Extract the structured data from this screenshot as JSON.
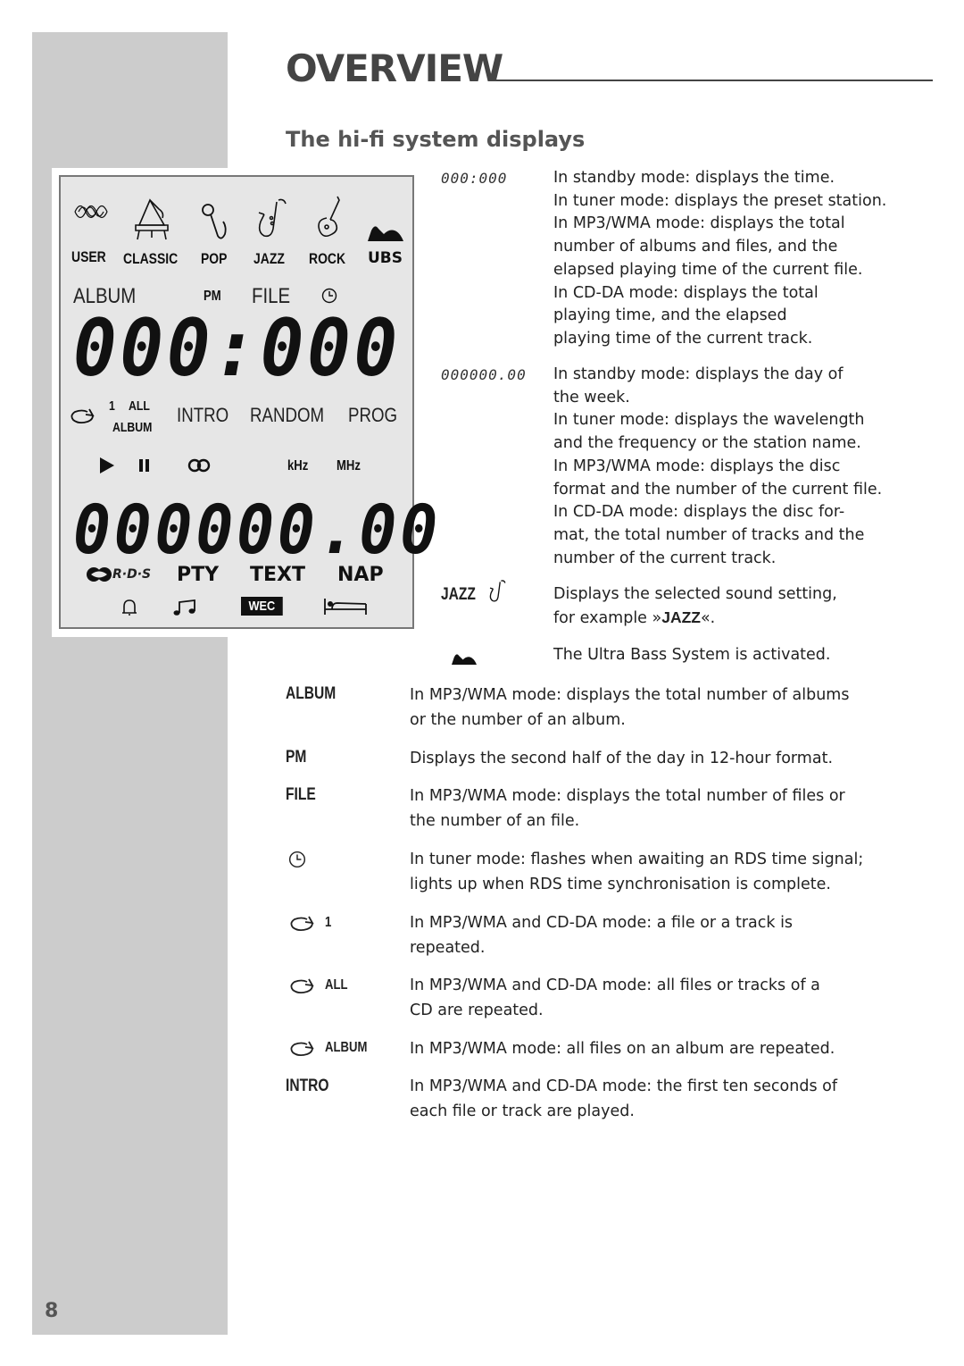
{
  "header": {
    "title": "OVERVIEW",
    "subtitle": "The hi-fi system displays"
  },
  "page_number": "8",
  "lcd": {
    "sound_modes": [
      {
        "label": "USER",
        "icon": "user-eq-icon"
      },
      {
        "label": "CLASSIC",
        "icon": "piano-icon"
      },
      {
        "label": "POP",
        "icon": "microphone-icon"
      },
      {
        "label": "JAZZ",
        "icon": "saxophone-icon"
      },
      {
        "label": "ROCK",
        "icon": "guitar-icon"
      },
      {
        "label": "UBS",
        "icon": "ubs-wave-icon"
      }
    ],
    "row2": {
      "album": "ALBUM",
      "pm": "PM",
      "file": "FILE",
      "clock_icon": "clock-icon"
    },
    "main_digits": "000:000",
    "repeat": {
      "one": "1",
      "all": "ALL",
      "album": "ALBUM",
      "icon": "repeat-icon"
    },
    "modes": {
      "intro": "INTRO",
      "random": "RANDOM",
      "prog": "PROG"
    },
    "row5": {
      "play_icon": "play-icon",
      "pause_icon": "pause-icon",
      "stereo_icon": "stereo-icon",
      "khz": "kHz",
      "mhz": "MHz"
    },
    "secondary_digits": "000000.00",
    "row7": {
      "rds": "R·D·S",
      "pty": "PTY",
      "text": "TEXT",
      "nap": "NAP"
    },
    "row8": {
      "bell_icon": "alarm-bell-icon",
      "music_icon": "music-note-icon",
      "wec": "WEC",
      "sleep_icon": "bed-icon"
    }
  },
  "descriptions_top": [
    {
      "term": "000:000",
      "lines": [
        "In standby mode: displays the time.",
        "In tuner mode: displays the preset station.",
        "In MP3/WMA mode: displays the total",
        "number of albums and files, and the",
        "elapsed playing time of the current file.",
        "In CD-DA mode: displays the total",
        "playing time, and the elapsed",
        "playing time of the current track."
      ]
    },
    {
      "term": "000000.00",
      "lines": [
        "In standby mode: displays the day of",
        "the week.",
        "In tuner mode: displays the wavelength",
        "and the frequency or the station name.",
        "In MP3/WMA mode: displays the disc",
        "format and the number of the current file.",
        "In CD-DA mode: displays the disc for-",
        "mat, the total number of tracks and the",
        "number of the current track."
      ]
    },
    {
      "term": "JAZZ",
      "lines": [
        "Displays the selected sound setting,"
      ],
      "example_prefix": "for example »",
      "example_bold": "JAZZ",
      "example_suffix": "«."
    },
    {
      "term": "",
      "icon": "ubs-wave-icon",
      "lines": [
        "The Ultra Bass System is activated."
      ]
    }
  ],
  "descriptions_bottom": [
    {
      "term": "ALBUM",
      "lines": [
        "In MP3/WMA mode: displays the total number of albums",
        "or the number of an album."
      ]
    },
    {
      "term": "PM",
      "lines": [
        "Displays the second half of the day in 12-hour format."
      ]
    },
    {
      "term": "FILE",
      "lines": [
        "In MP3/WMA mode: displays the total number of files or",
        "the number of an file."
      ]
    },
    {
      "term": "",
      "icon": "clock-icon",
      "lines": [
        "In tuner mode: flashes when awaiting an RDS time signal;",
        "lights up when RDS time synchronisation is complete."
      ]
    },
    {
      "term": "1",
      "icon": "repeat-icon",
      "lines": [
        "In MP3/WMA and CD-DA mode: a file or a track is",
        "repeated."
      ]
    },
    {
      "term": "ALL",
      "icon": "repeat-icon",
      "lines": [
        "In MP3/WMA and CD-DA mode: all files or tracks of a",
        "CD are repeated."
      ]
    },
    {
      "term": "ALBUM",
      "icon": "repeat-icon",
      "lines": [
        "In MP3/WMA mode: all files on an album are repeated."
      ]
    },
    {
      "term": "INTRO",
      "lines": [
        "In MP3/WMA and CD-DA mode: the first ten seconds of",
        "each file or track are played."
      ]
    }
  ]
}
